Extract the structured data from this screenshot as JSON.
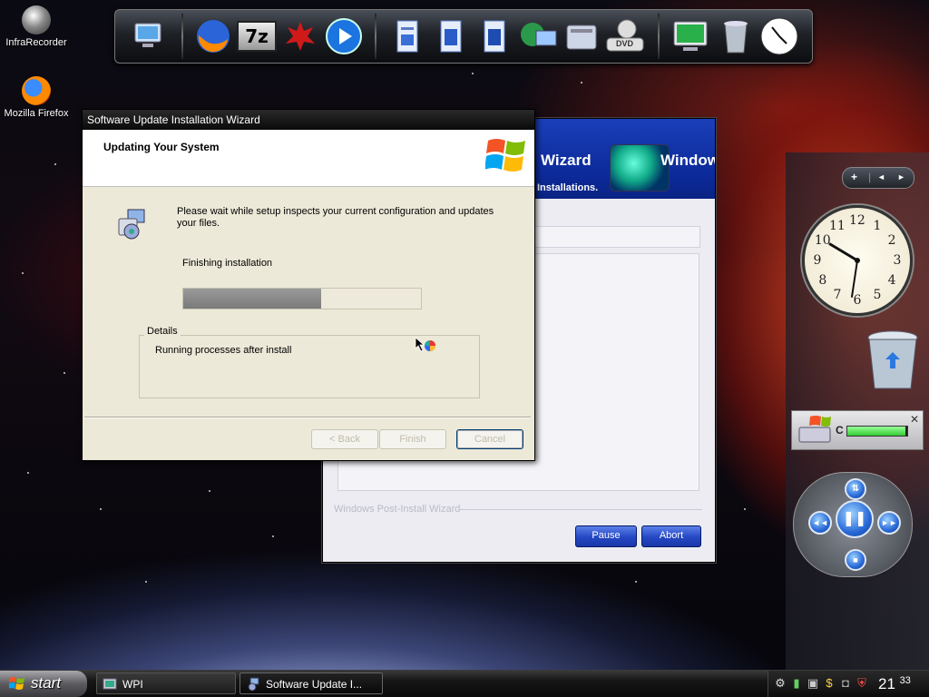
{
  "desktop": {
    "icons": [
      {
        "label": "InfraRecorder"
      },
      {
        "label": "Mozilla Firefox"
      }
    ]
  },
  "dock": {
    "items": [
      "computer-icon",
      "firefox-icon",
      "7zip-icon",
      "gecko-icon",
      "media-player-icon",
      "documents-icon",
      "music-icon",
      "videos-icon",
      "network-icon",
      "control-panel-icon",
      "dvd-icon",
      "display-icon",
      "recycle-bin-icon",
      "clock-icon"
    ],
    "sevenzip_label": "7z",
    "dvd_label": "DVD"
  },
  "wpi_window": {
    "banner_title_fragment": "Wizard",
    "banner_brand_fragment": "Window",
    "banner_subtitle_fragment": "Installations.",
    "footer_label": "Windows Post-Install Wizard",
    "pause_label": "Pause",
    "abort_label": "Abort"
  },
  "dialog": {
    "title": "Software Update Installation Wizard",
    "header_title": "Updating Your System",
    "body_text": "Please wait while setup inspects your current configuration and updates your files.",
    "status_text": "Finishing installation",
    "progress_fraction": 0.58,
    "details_legend": "Details",
    "details_text": "Running processes after install",
    "buttons": {
      "back": "< Back",
      "finish": "Finish",
      "cancel": "Cancel"
    }
  },
  "sidebar": {
    "nav": {
      "add": "+",
      "prev": "◄",
      "next": "►"
    },
    "clock_numbers": [
      "12",
      "1",
      "2",
      "3",
      "4",
      "5",
      "6",
      "7",
      "8",
      "9",
      "10",
      "11"
    ],
    "drive_label": "C",
    "drive_fill_fraction": 0.97
  },
  "taskbar": {
    "start_label": "start",
    "tasks": [
      {
        "label": "WPI"
      },
      {
        "label": "Software Update I..."
      }
    ],
    "time_hour": "21",
    "time_minute": "33"
  },
  "colors": {
    "xp_red": "#f35325",
    "xp_green": "#81bc06",
    "xp_blue": "#05a6f0",
    "xp_yellow": "#ffba08",
    "wpi_blue": "#0c2a9a"
  }
}
